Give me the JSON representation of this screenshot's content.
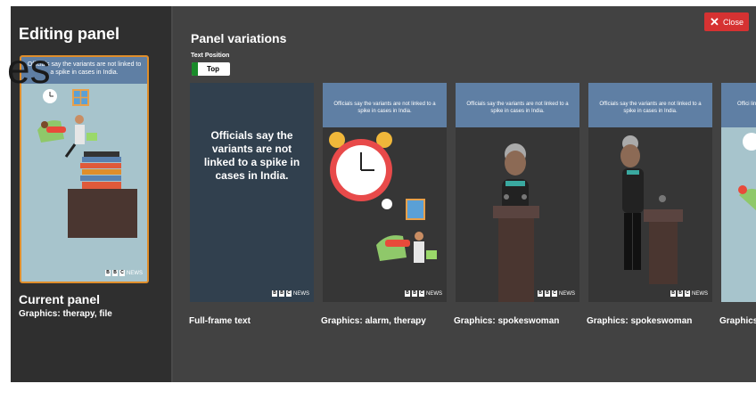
{
  "left_panel": {
    "title": "Editing panel",
    "background_fragment": "es",
    "current_card": {
      "caption": "Officials say the variants are not linked to a spike in cases in India.",
      "brand": "NEWS",
      "brand_letters": [
        "B",
        "B",
        "C"
      ]
    },
    "current_label": "Current panel",
    "current_subtitle": "Graphics: therapy, file"
  },
  "main": {
    "title": "Panel variations",
    "text_position_label": "Text Position",
    "toggle_value": "Top",
    "close_label": "Close",
    "variations": [
      {
        "label": "Full-frame text",
        "text": "Officials say the variants are not linked to a spike in cases in India.",
        "brand": "NEWS"
      },
      {
        "label": "Graphics: alarm, therapy",
        "caption": "Officials say the variants are not linked to a spike in cases in India.",
        "brand": "NEWS"
      },
      {
        "label": "Graphics: spokeswoman",
        "caption": "Officials say the variants are not linked to a spike in cases in India.",
        "brand": "NEWS"
      },
      {
        "label": "Graphics: spokeswoman",
        "caption": "Officials say the variants are not linked to a spike in cases in India.",
        "brand": "NEWS"
      },
      {
        "label": "Graphics",
        "caption": "Offici link"
      }
    ]
  },
  "colors": {
    "close_red": "#d63232",
    "current_border": "#e08e2b",
    "toggle_green": "#1a8a2a",
    "caption_blue": "#5f7fa4"
  }
}
